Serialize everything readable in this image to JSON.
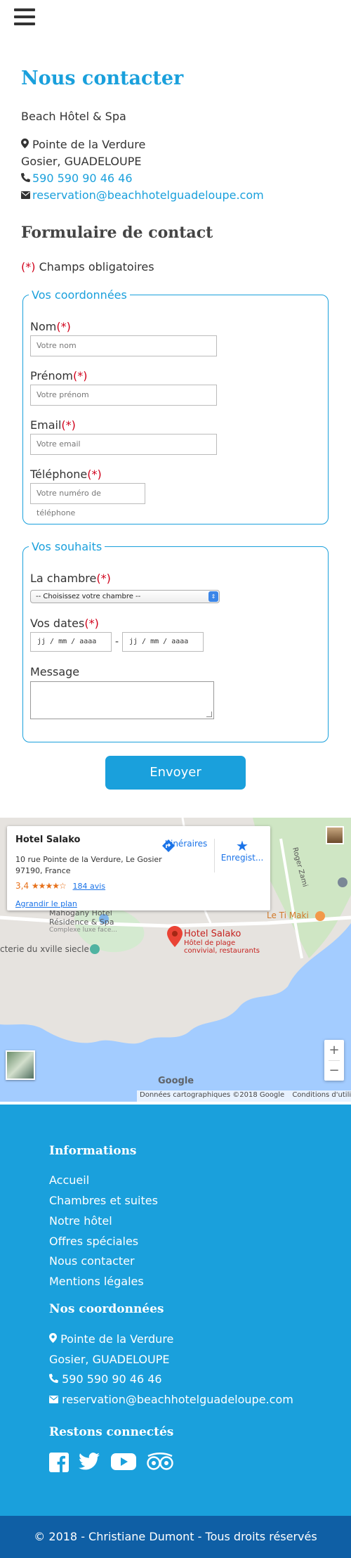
{
  "header": {
    "menu_icon": "hamburger-icon"
  },
  "contact": {
    "title": "Nous contacter",
    "hotel_name": "Beach Hôtel & Spa",
    "address_line1": "Pointe de la Verdure",
    "address_line2": "Gosier, GUADELOUPE",
    "phone": "590 590 90 46 46",
    "email": "reservation@beachhotelguadeloupe.com"
  },
  "form": {
    "title": "Formulaire de contact",
    "required_mark": "(*)",
    "required_note": " Champs obligatoires",
    "coordinates": {
      "legend": "Vos coordonnées",
      "name_label": "Nom",
      "name_placeholder": "Votre nom",
      "firstname_label": "Prénom",
      "firstname_placeholder": "Votre prénom",
      "email_label": "Email",
      "email_placeholder": "Votre email",
      "phone_label": "Téléphone",
      "phone_placeholder": "Votre numéro de téléphone"
    },
    "wishes": {
      "legend": "Vos souhaits",
      "room_label": "La chambre",
      "room_selected": "-- Choisissez votre chambre --",
      "dates_label": "Vos dates",
      "date_from": "jj / mm / aaaa",
      "date_separator": "-",
      "date_to": "jj / mm / aaaa",
      "message_label": "Message"
    },
    "submit_label": "Envoyer"
  },
  "map": {
    "card_title": "Hotel Salako",
    "card_address": "10 rue Pointe de la Verdure, Le Gosier 97190, France",
    "rating": "3,4",
    "rating_stars": "★★★★☆",
    "reviews": "184 avis",
    "enlarge": "Agrandir le plan",
    "directions_label": "Itinéraires",
    "save_label": "Enregist...",
    "pin_title": "Hotel Salako",
    "pin_sub1": "Hôtel de plage",
    "pin_sub2": "convivial, restaurants",
    "poi_1_line1": "Mahogany Hôtel",
    "poi_1_line2": "Résidence & Spa",
    "poi_1_line3": "Complexe luxe face...",
    "poi_2": "cterie du xville siecle",
    "poi_3": "Le Ti Maki",
    "road_label": "Roger Zami",
    "logo": "Google",
    "copyright": "Données cartographiques ©2018 Google",
    "terms": "Conditions d'utilisation",
    "zoom_in": "+",
    "zoom_out": "−"
  },
  "footer": {
    "info_title": "Informations",
    "links": [
      "Accueil",
      "Chambres et suites",
      "Notre hôtel",
      "Offres spéciales",
      "Nous contacter",
      "Mentions légales"
    ],
    "coords_title": "Nos coordonnées",
    "address_line1": "Pointe de la Verdure",
    "address_line2": "Gosier, GUADELOUPE",
    "phone": "590 590 90 46 46",
    "email": "reservation@beachhotelguadeloupe.com",
    "social_title": "Restons connectés",
    "social_icons": [
      "facebook-icon",
      "twitter-icon",
      "youtube-icon",
      "tripadvisor-icon"
    ],
    "copyright": "© 2018 - Christiane Dumont - Tous droits réservés"
  },
  "colors": {
    "accent": "#1aa0dc",
    "required": "#d0021b",
    "bottom_bar": "#0f5fa5"
  }
}
